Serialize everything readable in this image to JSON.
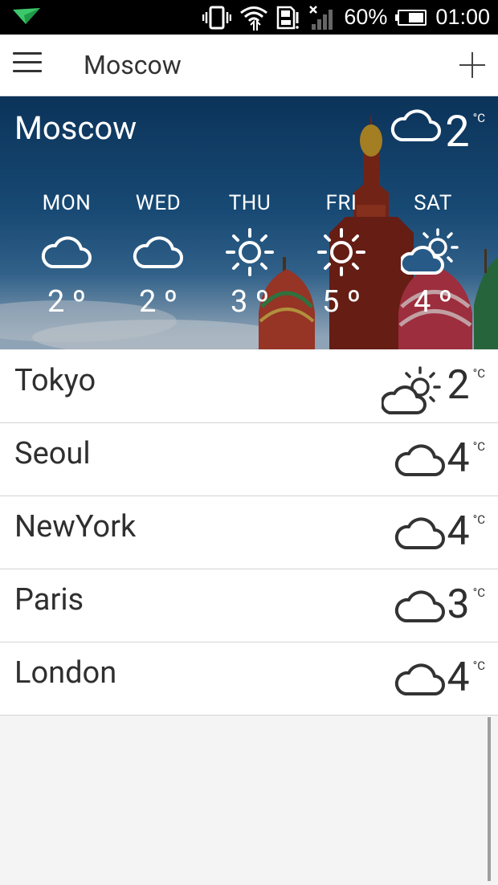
{
  "status_bar": {
    "battery_percent": "60%",
    "battery_level": 0.6,
    "time": "01:00",
    "icons": [
      "notification-plane-icon",
      "vibrate-icon",
      "wifi-icon",
      "sd-card-icon",
      "no-signal-icon",
      "battery-icon"
    ]
  },
  "app_bar": {
    "title": "Moscow",
    "menu_icon": "hamburger-menu-icon",
    "add_icon": "plus-icon"
  },
  "hero": {
    "city": "Moscow",
    "current_temp": "2",
    "unit": "°C",
    "current_icon": "cloud-icon",
    "forecast": [
      {
        "day": "MON",
        "temp": "2 º",
        "icon": "cloud-icon"
      },
      {
        "day": "WED",
        "temp": "2 º",
        "icon": "cloud-icon"
      },
      {
        "day": "THU",
        "temp": "3 º",
        "icon": "sun-icon"
      },
      {
        "day": "FRI",
        "temp": "5 º",
        "icon": "sun-icon"
      },
      {
        "day": "SAT",
        "temp": "4 º",
        "icon": "partly-cloudy-icon"
      }
    ]
  },
  "cities": [
    {
      "name": "Tokyo",
      "temp": "2",
      "unit": "°C",
      "icon": "partly-cloudy-icon"
    },
    {
      "name": "Seoul",
      "temp": "4",
      "unit": "°C",
      "icon": "cloud-icon"
    },
    {
      "name": "NewYork",
      "temp": "4",
      "unit": "°C",
      "icon": "cloud-icon"
    },
    {
      "name": "Paris",
      "temp": "3",
      "unit": "°C",
      "icon": "cloud-icon"
    },
    {
      "name": "London",
      "temp": "4",
      "unit": "°C",
      "icon": "cloud-icon"
    }
  ],
  "colors": {
    "status_bar": "#000000",
    "hero_sky": "#1d5a8e",
    "list_bg": "#ffffff",
    "text": "#2f2f2f"
  }
}
